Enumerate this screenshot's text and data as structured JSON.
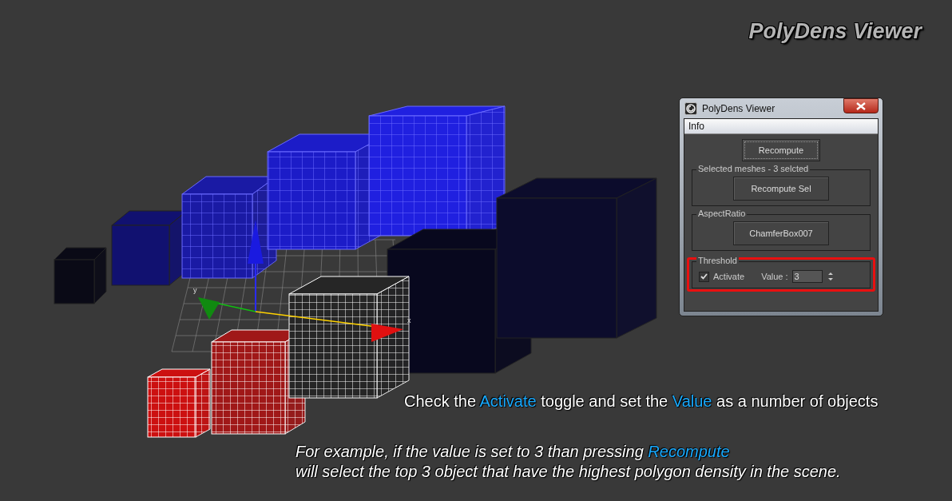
{
  "heading": "PolyDens Viewer",
  "scene": {
    "axis_labels": [
      "y",
      "x"
    ]
  },
  "dialog": {
    "title": "PolyDens Viewer",
    "rollout": "Info",
    "main_button": "Recompute",
    "groups": [
      {
        "kind": "button",
        "legend": "Selected meshes - 3 selcted",
        "button": "Recompute Sel",
        "highlighted": false
      },
      {
        "kind": "button",
        "legend": "AspectRatio",
        "button": "ChamferBox007",
        "highlighted": false
      },
      {
        "kind": "threshold",
        "legend": "Threshold",
        "highlighted": true,
        "checkbox": {
          "label": "Activate",
          "checked": true
        },
        "spinner": {
          "label": "Value :",
          "value": "3"
        }
      }
    ]
  },
  "captions": [
    {
      "kind": "plain",
      "lines": [
        [
          {
            "text": "Check the ",
            "highlight": false
          },
          {
            "text": "Activate",
            "highlight": true
          },
          {
            "text": " toggle and set the ",
            "highlight": false
          },
          {
            "text": "Value",
            "highlight": true
          },
          {
            "text": " as a number of objects",
            "highlight": false
          }
        ]
      ]
    },
    {
      "kind": "italic",
      "lines": [
        [
          {
            "text": "For example, if the value is set to 3 than pressing ",
            "highlight": false
          },
          {
            "text": "Recompute",
            "highlight": true
          }
        ],
        [
          {
            "text": "will select the top 3 object that have the highest polygon density in the scene.",
            "highlight": false
          }
        ]
      ]
    }
  ]
}
